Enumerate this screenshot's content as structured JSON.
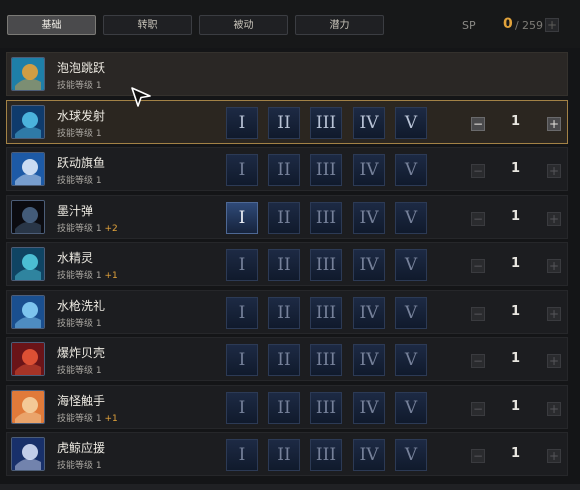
{
  "tabs": [
    {
      "label": "基础",
      "active": true
    },
    {
      "label": "转职",
      "active": false
    },
    {
      "label": "被动",
      "active": false
    },
    {
      "label": "潜力",
      "active": false
    }
  ],
  "sp": {
    "label": "SP",
    "current": "0",
    "separator": "/",
    "max": "259",
    "plus": "+"
  },
  "tiers": [
    "I",
    "II",
    "III",
    "IV",
    "V"
  ],
  "skills": [
    {
      "name": "泡泡跳跃",
      "level_text": "技能等级 1",
      "bonus": "",
      "icon": "bubble-jump-icon",
      "colors": [
        "#1e7fa8",
        "#f0a232"
      ],
      "has_tiers": false
    },
    {
      "name": "水球发射",
      "level_text": "技能等级 1",
      "bonus": "",
      "icon": "water-ball-icon",
      "colors": [
        "#0f3b6c",
        "#56c8f0"
      ],
      "has_tiers": true,
      "count": "1",
      "selected": true
    },
    {
      "name": "跃动旗鱼",
      "level_text": "技能等级 1",
      "bonus": "",
      "icon": "swordfish-icon",
      "colors": [
        "#1d5aa6",
        "#e9f2ff"
      ],
      "has_tiers": true,
      "count": "1"
    },
    {
      "name": "墨汁弹",
      "level_text": "技能等级 1",
      "bonus": "+2",
      "icon": "ink-bomb-icon",
      "colors": [
        "#0b0b10",
        "#4d6a8c"
      ],
      "has_tiers": true,
      "count": "1",
      "lit_tier": 0
    },
    {
      "name": "水精灵",
      "level_text": "技能等级 1",
      "bonus": "+1",
      "icon": "water-spirit-icon",
      "colors": [
        "#0f4463",
        "#56d3e8"
      ],
      "has_tiers": true,
      "count": "1"
    },
    {
      "name": "水枪洗礼",
      "level_text": "技能等级 1",
      "bonus": "",
      "icon": "water-gun-icon",
      "colors": [
        "#1a4f8f",
        "#8fd8ff"
      ],
      "has_tiers": true,
      "count": "1"
    },
    {
      "name": "爆炸贝壳",
      "level_text": "技能等级 1",
      "bonus": "",
      "icon": "explosive-shell-icon",
      "colors": [
        "#6a1418",
        "#f05a3a"
      ],
      "has_tiers": true,
      "count": "1"
    },
    {
      "name": "海怪触手",
      "level_text": "技能等级 1",
      "bonus": "+1",
      "icon": "sea-monster-tentacle-icon",
      "colors": [
        "#e07a3a",
        "#f6d7a8"
      ],
      "has_tiers": true,
      "count": "1"
    },
    {
      "name": "虎鲸应援",
      "level_text": "技能等级 1",
      "bonus": "",
      "icon": "orca-support-icon",
      "colors": [
        "#18306a",
        "#dfe9ff"
      ],
      "has_tiers": true,
      "count": "1"
    }
  ]
}
